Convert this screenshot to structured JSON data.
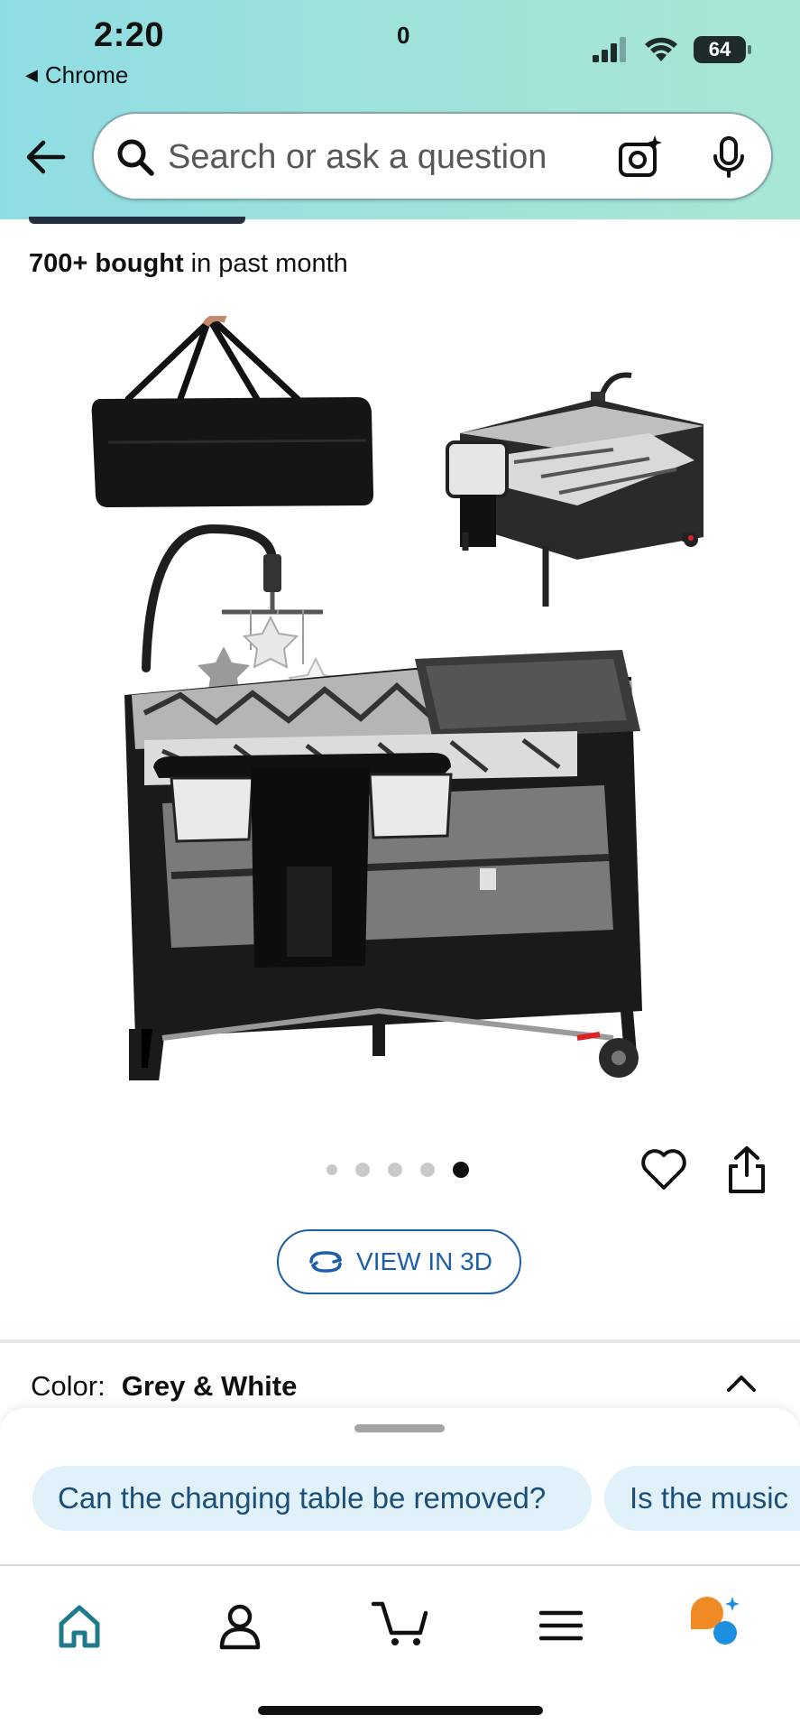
{
  "status_bar": {
    "time": "2:20",
    "back_app": "Chrome",
    "battery": "64"
  },
  "search": {
    "placeholder": "Search or ask a question"
  },
  "product": {
    "bought_count": "700+ bought",
    "bought_suffix": "in past month",
    "image_dots": {
      "count": 5,
      "active_index": 4
    },
    "view_3d_label": "VIEW IN 3D"
  },
  "variation": {
    "color_label": "Color:",
    "color_value": "Grey & White"
  },
  "suggestions": {
    "chips": [
      "Can the changing table be removed?",
      "Is the music"
    ]
  },
  "tabbar": {
    "cart_count": "0",
    "items": [
      "home-icon",
      "account-icon",
      "cart-icon",
      "menu-icon",
      "rufus-icon"
    ]
  },
  "colors": {
    "header_gradient_start": "#8fdde4",
    "header_gradient_end": "#a9e6d5",
    "link_blue": "#1c5fa8",
    "home_active": "#1f7a8c",
    "chip_bg": "#e1f1fa",
    "rufus_orange": "#f08a24",
    "rufus_blue": "#1d8fe0"
  }
}
